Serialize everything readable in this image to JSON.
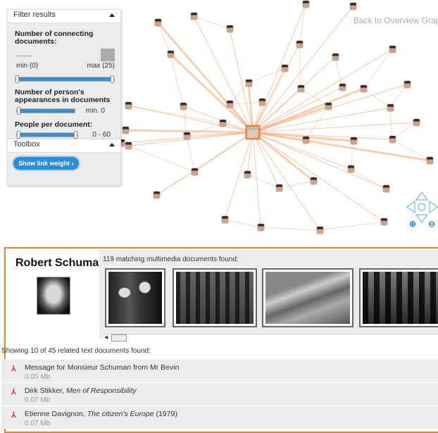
{
  "graph": {
    "back_link": "Back to Overview Graph",
    "accent": "#e8852f"
  },
  "filter": {
    "title": "Filter results",
    "connecting_label": "Number of connecting documents:",
    "min_label": "min (0)",
    "max_label": "max (25)",
    "appearances_label": "Number of person's appearances in documents",
    "appearances_value": "min. 0",
    "people_label": "People per document:",
    "people_value": "0 - 60"
  },
  "toolbox": {
    "title": "Toolbox",
    "show_link_weight": "Show link weight"
  },
  "card": {
    "person_name": "Robert Schuman",
    "media_count_label": "119 matching multimedia documents found:",
    "docs_count_label": "Showing 10 of 45 related text documents found:",
    "docs": [
      {
        "pre": "Message for Monsieur Schuman from Mr Bevin",
        "em": "",
        "post": "",
        "size": "0.05 Mb"
      },
      {
        "pre": "Dirk Stikker, ",
        "em": "Men of Responsibility",
        "post": "",
        "size": "0.07 Mb"
      },
      {
        "pre": "Etienne Davignon, ",
        "em": "The citizen's Europe",
        "post": " (1979)",
        "size": "0.07 Mb"
      }
    ]
  }
}
